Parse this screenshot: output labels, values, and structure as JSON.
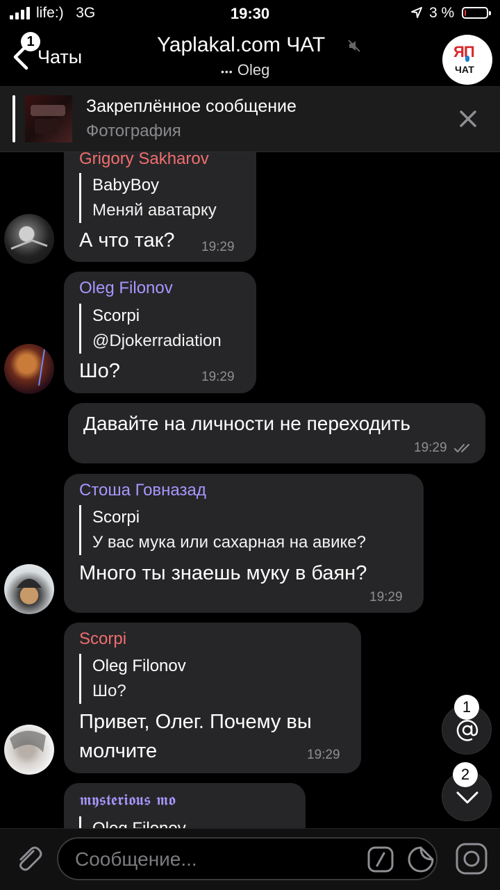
{
  "status_bar": {
    "carrier": "life:)",
    "network": "3G",
    "time": "19:30",
    "battery": "3 %"
  },
  "header": {
    "back_badge": "1",
    "back_label": "Чаты",
    "title": "Yaplakal.com ЧАТ",
    "typing_dots": "•••",
    "typing_user": "Oleg",
    "avatar_logo_top": "ЯП",
    "avatar_logo_bottom": "ЧАТ"
  },
  "pinned": {
    "title": "Закреплённое сообщение",
    "subtitle": "Фотография"
  },
  "colors": {
    "accent_red": "#f06e6e",
    "accent_purple": "#a797ff",
    "bubble": "#262628",
    "background": "#000000"
  },
  "messages": [
    {
      "sender": "Grigory Sakharov",
      "reply_name": "BabyBoy",
      "reply_text": "Меняй аватарку",
      "text": "А что так?",
      "time": "19:29"
    },
    {
      "sender": "Oleg Filonov",
      "reply_name": "Scorpi",
      "reply_text": "@Djokerradiation",
      "text": "Шо?",
      "time": "19:29"
    },
    {
      "outgoing": true,
      "text": "Давайте на личности не переходить",
      "time": "19:29"
    },
    {
      "sender": "Стоша Говназад",
      "reply_name": "Scorpi",
      "reply_text": "У вас мука или сахарная на авике?",
      "text": "Много ты знаешь муку в баян?",
      "time": "19:29"
    },
    {
      "sender": "Scorpi",
      "reply_name": "Oleg Filonov",
      "reply_text": "Шо?",
      "text_line1": "Привет, Олег. Почему вы",
      "text_line2": "молчите",
      "time": "19:29"
    },
    {
      "sender": "𝖒𝖞𝖘𝖙𝖊𝖗𝖎𝖔𝖚𝖘 𝖒𝖔",
      "reply_name": "Oleg Filonov"
    }
  ],
  "fabs": {
    "mentions_count": "1",
    "unread_count": "2"
  },
  "input": {
    "placeholder": "Сообщение..."
  }
}
